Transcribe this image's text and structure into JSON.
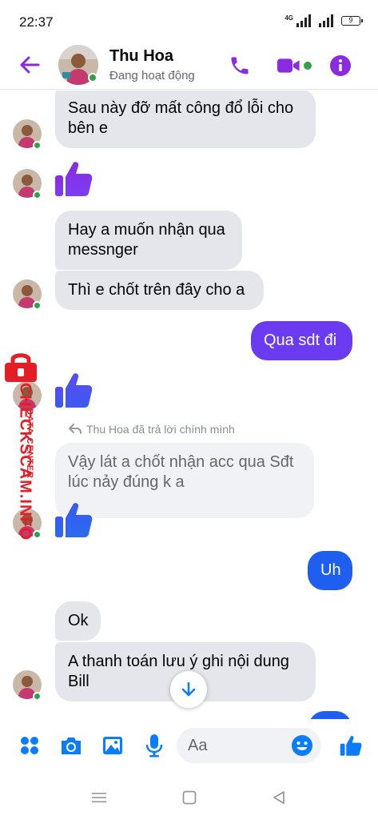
{
  "status_bar": {
    "time": "22:37",
    "network": "4G",
    "battery": "9"
  },
  "header": {
    "name": "Thu Hoa",
    "status": "Đang hoạt động"
  },
  "messages": [
    {
      "side": "in",
      "text": "Sau này đỡ mất công đổ lỗi cho bên e"
    },
    {
      "side": "in",
      "type": "like"
    },
    {
      "side": "in",
      "text": "Hay a muốn nhận qua messnger"
    },
    {
      "side": "in",
      "text": "Thì e chốt trên đây cho a"
    },
    {
      "side": "out",
      "text": "Qua sdt đi"
    },
    {
      "side": "in",
      "type": "like"
    },
    {
      "side": "in",
      "reply_label": "Thu Hoa đã trả lời chính mình",
      "text": "Vậy lát a chốt nhận acc qua Sđt lúc nảy đúng k a"
    },
    {
      "side": "in",
      "type": "like"
    },
    {
      "side": "out",
      "text": "Uh"
    },
    {
      "side": "in",
      "text": "Ok"
    },
    {
      "side": "in",
      "text": "A thanh toán lưu ý ghi nội dung Bill"
    }
  ],
  "watermark": {
    "main": "CHECKSCAM.INFO",
    "sub": "DATA CENTER"
  },
  "composer": {
    "placeholder": "Aa"
  },
  "colors": {
    "accent": "#8a2be2",
    "outgoing_gradient": [
      "#6b3bf2",
      "#1e5ff0"
    ],
    "messenger_blue": "#0a7cff",
    "online": "#31a24c"
  },
  "icons": [
    "back-arrow-icon",
    "phone-icon",
    "video-icon",
    "info-icon",
    "apps-icon",
    "camera-icon",
    "image-icon",
    "mic-icon",
    "emoji-icon",
    "like-icon",
    "chevron-down-icon",
    "menu-icon",
    "home-icon",
    "back-nav-icon"
  ]
}
